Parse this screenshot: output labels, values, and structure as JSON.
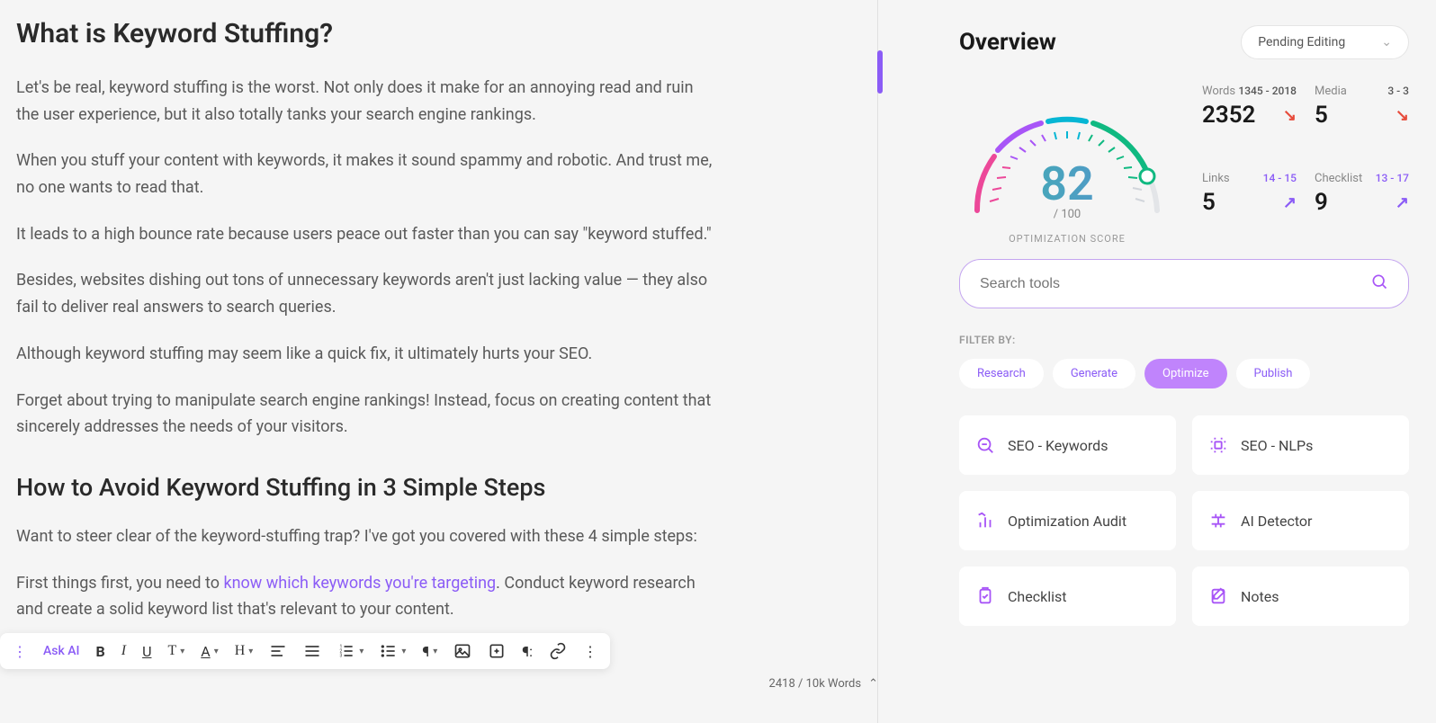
{
  "editor": {
    "h1": "What is Keyword Stuffing?",
    "p1": "Let's be real, keyword stuffing is the worst. Not only does it make for an annoying read and ruin the user experience, but it also totally tanks your search engine rankings.",
    "p2": "When you stuff your content with keywords, it makes it sound spammy and robotic. And trust me, no one wants to read that.",
    "p3": "It leads to a high bounce rate because users peace out faster than you can say \"keyword stuffed.\"",
    "p4": "Besides, websites dishing out tons of unnecessary keywords aren't just lacking value — they also fail to deliver real answers to search queries.",
    "p5": "Although keyword stuffing may seem like a quick fix, it ultimately hurts your SEO.",
    "p6": "Forget about trying to manipulate search engine rankings! Instead, focus on creating content that sincerely addresses the needs of your visitors.",
    "h2": "How to Avoid Keyword Stuffing in 3 Simple Steps",
    "p7": "Want to steer clear of the keyword-stuffing trap? I've got you covered with these 4 simple steps:",
    "p8a": "First things first, you need to ",
    "p8link": "know which keywords you're targeting",
    "p8b": ". Conduct keyword research and create a solid keyword list that's relevant to your content."
  },
  "toolbar": {
    "ask_ai": "Ask AI"
  },
  "word_counter": "2418 / 10k Words",
  "overview": {
    "title": "Overview",
    "status": "Pending Editing",
    "score": "82",
    "score_denom": "/ 100",
    "score_label": "OPTIMIZATION SCORE",
    "stats": {
      "words": {
        "label": "Words",
        "range": "1345 - 2018",
        "value": "2352"
      },
      "media": {
        "label": "Media",
        "range": "3 - 3",
        "value": "5"
      },
      "links": {
        "label": "Links",
        "range": "14 - 15",
        "value": "5"
      },
      "checklist": {
        "label": "Checklist",
        "range": "13 - 17",
        "value": "9"
      }
    }
  },
  "search": {
    "placeholder": "Search tools"
  },
  "filter": {
    "label": "FILTER BY:",
    "pills": [
      "Research",
      "Generate",
      "Optimize",
      "Publish"
    ]
  },
  "tools": {
    "seo_keywords": "SEO - Keywords",
    "seo_nlp": "SEO - NLPs",
    "audit": "Optimization Audit",
    "ai_detector": "AI Detector",
    "checklist": "Checklist",
    "notes": "Notes"
  }
}
